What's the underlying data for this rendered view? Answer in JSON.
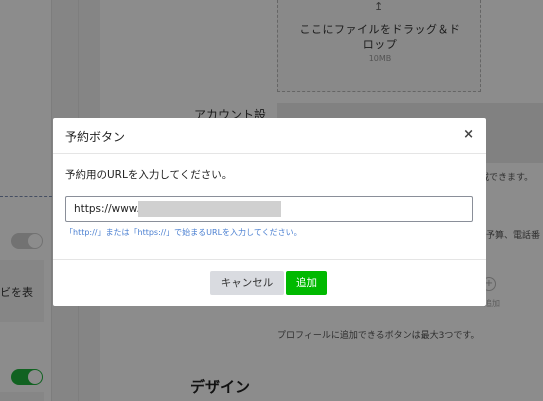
{
  "background": {
    "upload_arrow": "↥",
    "upload_text": "ここにファイルをドラッグ＆ドロップ",
    "upload_size": "10MB",
    "account_label": "アカウント設",
    "side_note": "載できます。",
    "side_note2": "予算、電話番",
    "add_label": "追加",
    "left_partial": "ビを表",
    "button_limit_note": "プロフィールに追加できるボタンは最大3つです。",
    "design_heading": "デザイン"
  },
  "modal": {
    "title": "予約ボタン",
    "close_icon": "×",
    "description": "予約用のURLを入力してください。",
    "url_value": "https://www.",
    "url_hint": "「http://」または「https://」で始まるURLを入力してください。",
    "cancel_label": "キャンセル",
    "add_label": "追加"
  },
  "colors": {
    "accent_green": "#00b900",
    "hint_blue": "#4a7fd1"
  }
}
